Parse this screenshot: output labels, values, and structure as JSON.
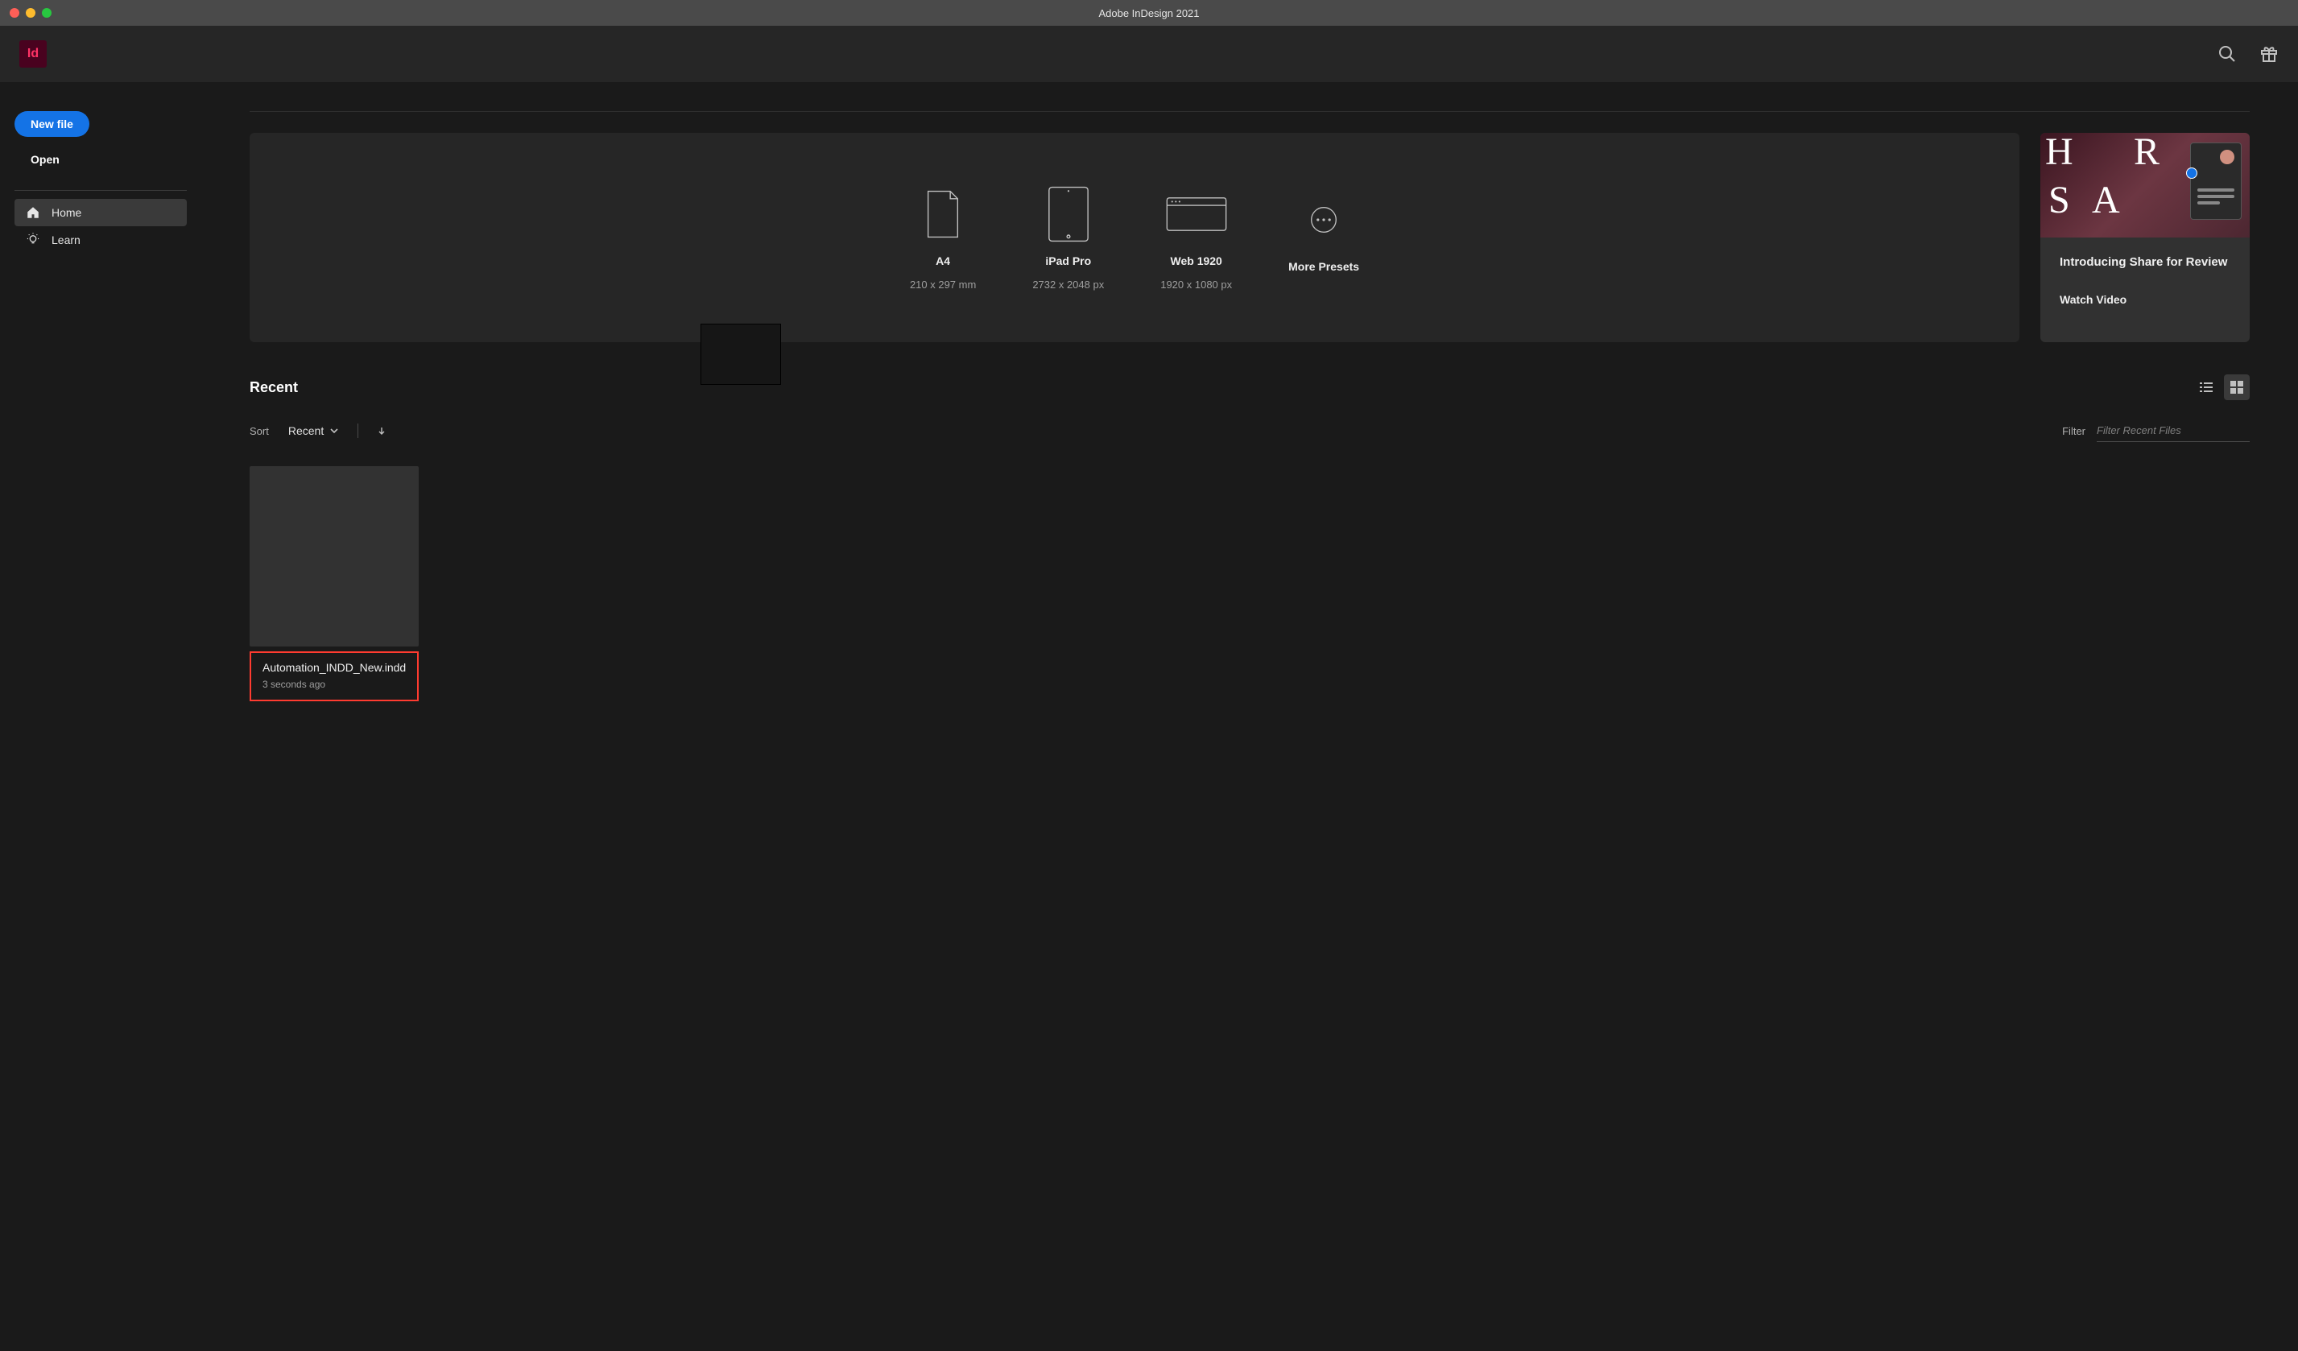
{
  "window": {
    "title": "Adobe InDesign 2021"
  },
  "app": {
    "logo_text": "Id"
  },
  "sidebar": {
    "new_file_label": "New file",
    "open_label": "Open",
    "nav": {
      "home": "Home",
      "learn": "Learn"
    }
  },
  "presets": {
    "items": [
      {
        "name": "A4",
        "sub": "210 x 297 mm"
      },
      {
        "name": "iPad Pro",
        "sub": "2732 x 2048 px"
      },
      {
        "name": "Web 1920",
        "sub": "1920 x 1080 px"
      },
      {
        "name": "More Presets",
        "sub": ""
      }
    ]
  },
  "promo": {
    "title": "Introducing Share for Review",
    "cta": "Watch Video"
  },
  "recent": {
    "heading": "Recent",
    "sort_label": "Sort",
    "sort_value": "Recent",
    "filter_label": "Filter",
    "filter_placeholder": "Filter Recent Files",
    "items": [
      {
        "name": "Automation_INDD_New.indd",
        "time": "3 seconds ago"
      }
    ]
  }
}
